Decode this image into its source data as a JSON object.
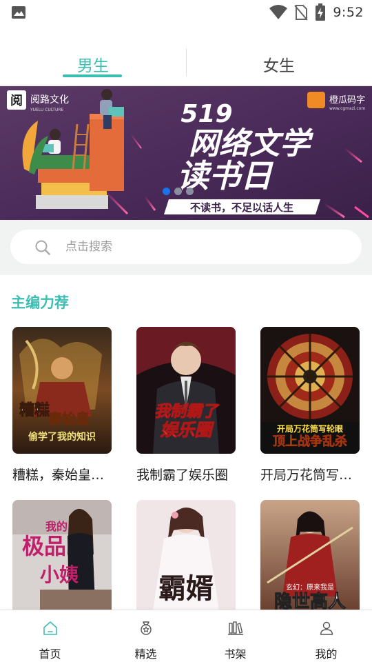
{
  "status_bar": {
    "time": "9:52",
    "icons": [
      "image-icon",
      "wifi-icon",
      "sim-off-icon",
      "battery-charging-icon"
    ]
  },
  "tabs": [
    {
      "label": "男生",
      "active": true
    },
    {
      "label": "女生",
      "active": false
    }
  ],
  "banner": {
    "publisher": "阅路文化",
    "publisher_en": "YUELU CULTURE",
    "partner": "橙瓜码字",
    "partner_url": "www.cgmazi.com",
    "headline_number": "519",
    "headline_line1": "网络文学",
    "headline_line2": "读书日",
    "slogan": "不读书，不足以话人生",
    "dots": 3,
    "active_dot": 0
  },
  "search": {
    "placeholder": "点击搜索"
  },
  "section": {
    "title": "主编力荐"
  },
  "books": [
    {
      "title": "糟糕，秦始皇…",
      "cover_text": [
        "糟糕",
        "秦始皇",
        "偷学了我的知识"
      ]
    },
    {
      "title": "我制霸了娱乐圈",
      "cover_text": [
        "我制霸了",
        "娱乐圈"
      ]
    },
    {
      "title": "开局万花筒写…",
      "cover_text": [
        "开局万花筒写轮眼",
        "顶上战争乱杀"
      ]
    },
    {
      "title": "",
      "cover_text": [
        "我的",
        "极品",
        "小姨"
      ]
    },
    {
      "title": "",
      "cover_text": [
        "霸婿"
      ]
    },
    {
      "title": "",
      "cover_text": [
        "玄幻：原来我是",
        "隐世高人"
      ]
    }
  ],
  "bottom_nav": [
    {
      "label": "首页",
      "icon": "home-icon",
      "active": true
    },
    {
      "label": "精选",
      "icon": "featured-icon",
      "active": false
    },
    {
      "label": "书架",
      "icon": "bookshelf-icon",
      "active": false
    },
    {
      "label": "我的",
      "icon": "profile-icon",
      "active": false
    }
  ],
  "colors": {
    "accent": "#3bbdb1",
    "text": "#222222",
    "search_bg": "#f1f2f2"
  }
}
